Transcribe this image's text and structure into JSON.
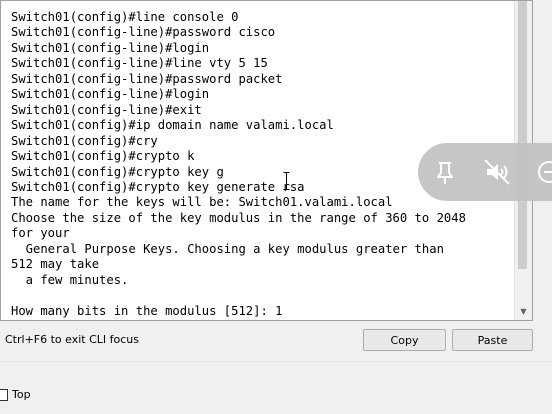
{
  "terminal": {
    "lines": [
      "Switch01(config)#line console 0",
      "Switch01(config-line)#password cisco",
      "Switch01(config-line)#login",
      "Switch01(config-line)#line vty 5 15",
      "Switch01(config-line)#password packet",
      "Switch01(config-line)#login",
      "Switch01(config-line)#exit",
      "Switch01(config)#ip domain name valami.local",
      "Switch01(config)#cry",
      "Switch01(config)#crypto k",
      "Switch01(config)#crypto key g",
      "Switch01(config)#crypto key generate rsa",
      "The name for the keys will be: Switch01.valami.local",
      "Choose the size of the key modulus in the range of 360 to 2048",
      "for your",
      "  General Purpose Keys. Choosing a key modulus greater than",
      "512 may take",
      "  a few minutes.",
      "",
      "How many bits in the modulus [512]: 1"
    ]
  },
  "footer": {
    "hint": "Ctrl+F6 to exit CLI focus",
    "copy_label": "Copy",
    "paste_label": "Paste"
  },
  "options": {
    "top_label": "Top"
  },
  "icons": {
    "pin": "pin-icon",
    "mute": "speaker-muted-icon",
    "extra": "minus-circle-icon",
    "text_cursor": "i-beam-cursor-icon",
    "scroll_down": "scroll-down-arrow-icon"
  },
  "colors": {
    "terminal_background": "#ffffff",
    "terminal_text": "#000000",
    "window_background": "#f0f0f0",
    "floating_bar": "#c2c2c2"
  }
}
